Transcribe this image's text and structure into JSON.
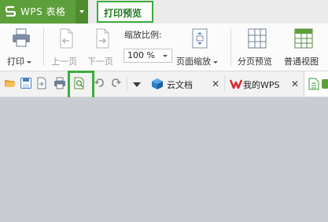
{
  "app": {
    "title": "WPS 表格"
  },
  "tabs": [
    {
      "label": "打印预览",
      "active": true
    }
  ],
  "ribbon": {
    "print_label": "打印",
    "prev_page_label": "上一页",
    "next_page_label": "下一页",
    "zoom_ratio_label": "缩放比例:",
    "zoom_value": "100 %",
    "page_zoom_label": "页面缩放",
    "page_break_preview_label": "分页预览",
    "normal_view_label": "普通视图"
  },
  "doc_tabs": [
    {
      "label": "云文档"
    },
    {
      "label": "我的WPS"
    }
  ],
  "colors": {
    "brand_green": "#5d9f3a",
    "highlight_green": "#3cac3c",
    "wps_red": "#d8272d",
    "workspace": "#c9ccd3"
  }
}
